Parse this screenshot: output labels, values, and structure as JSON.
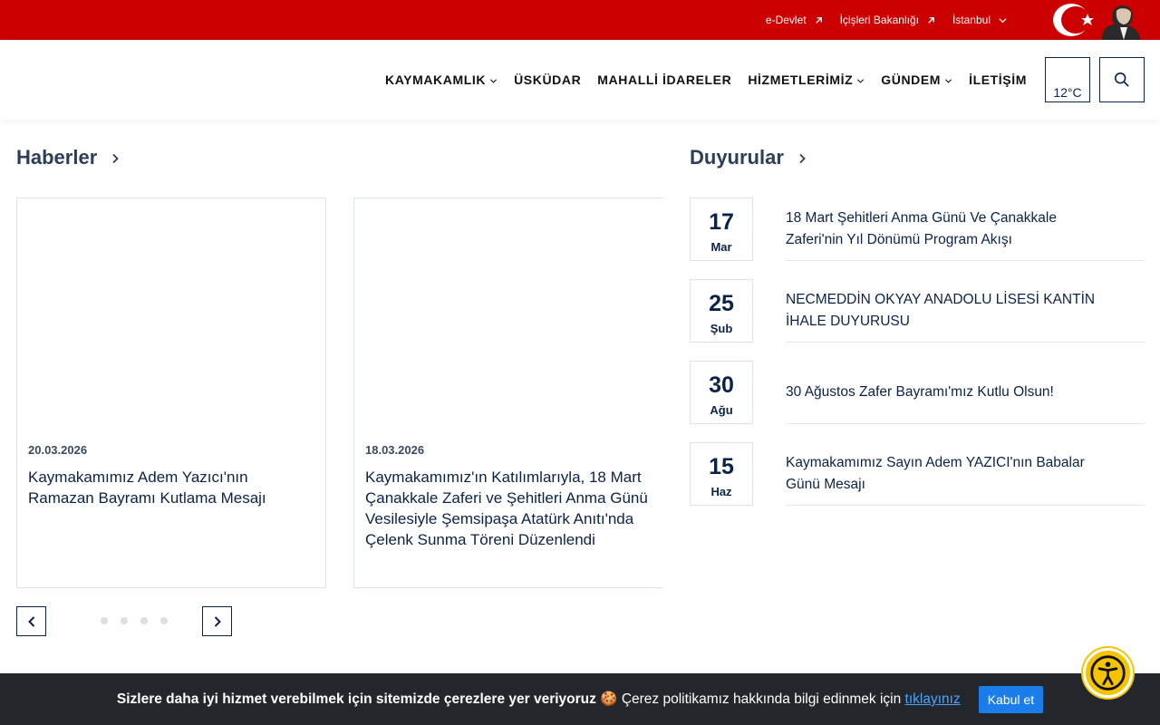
{
  "topbar": {
    "links": [
      {
        "label": "e-Devlet"
      },
      {
        "label": "İçişleri Bakanlığı"
      },
      {
        "label": "İstanbul"
      }
    ]
  },
  "nav": {
    "items": [
      {
        "label": "KAYMAKAMLIK"
      },
      {
        "label": "ÜSKÜDAR"
      },
      {
        "label": "MAHALLİ İDARELER"
      },
      {
        "label": "HİZMETLERİMİZ"
      },
      {
        "label": "GÜNDEM"
      },
      {
        "label": "İLETİŞİM"
      }
    ],
    "weather": "12°C"
  },
  "news": {
    "heading": "Haberler",
    "cards": [
      {
        "date": "20.03.2026",
        "title": "Kaymakamımız Adem Yazıcı'nın Ramazan Bayramı Kutlama Mesajı"
      },
      {
        "date": "18.03.2026",
        "title": "Kaymakamımız'ın Katılımlarıyla, 18 Mart Çanakkale Zaferi ve Şehitleri Anma Günü Vesilesiyle Şemsipaşa Atatürk Anıtı'nda Çelenk Sunma Töreni Düzenlendi"
      }
    ]
  },
  "announcements": {
    "heading": "Duyurular",
    "items": [
      {
        "day": "17",
        "month": "Mar",
        "text": "18 Mart Şehitleri Anma Günü Ve Çanakkale Zaferi'nin Yıl Dönümü Program Akışı"
      },
      {
        "day": "25",
        "month": "Şub",
        "text": "NECMEDDİN OKYAY ANADOLU LİSESİ KANTİN İHALE DUYURUSU"
      },
      {
        "day": "30",
        "month": "Ağu",
        "text": "30 Ağustos Zafer Bayramı'mız Kutlu Olsun!"
      },
      {
        "day": "15",
        "month": "Haz",
        "text": "Kaymakamımız Sayın Adem YAZICI'nın Babalar Günü Mesajı"
      }
    ]
  },
  "cookie": {
    "bold": "Sizlere daha iyi hizmet verebilmek için sitemizde çerezlere yer veriyoruz",
    "emoji": "🍪",
    "rest": "Çerez politikamız hakkında bilgi edinmek için",
    "link": "tıklayınız",
    "accept": "Kabul et"
  },
  "colors": {
    "topbar": "#cc0000",
    "navy": "#0b2348",
    "cookie_bg": "#23272b",
    "accept_btn": "#1a7dea",
    "accessibility": "#f5c300"
  },
  "icons": [
    "external-link-icon",
    "chevron-down-icon",
    "search-icon",
    "chevron-right-icon",
    "chevron-left-icon",
    "accessibility-icon"
  ]
}
